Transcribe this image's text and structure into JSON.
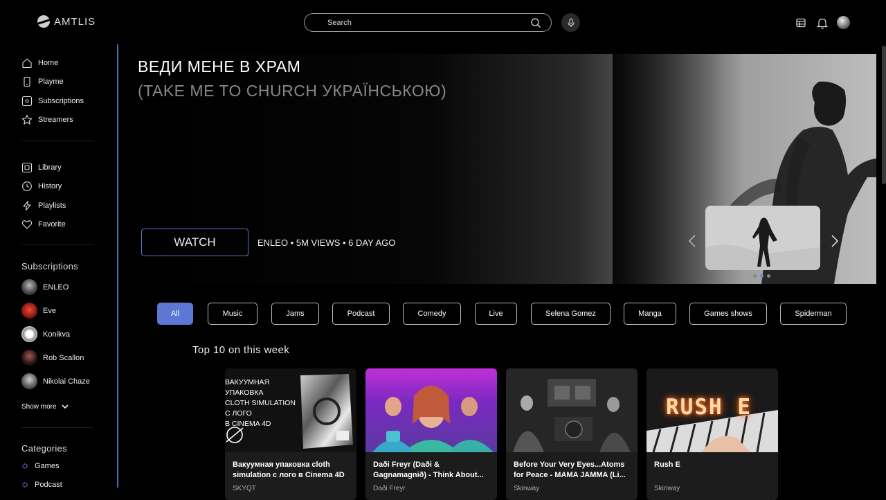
{
  "header": {
    "logo_text": "AMTLIS",
    "search_placeholder": "Search"
  },
  "sidebar": {
    "nav": [
      {
        "label": "Home",
        "icon": "home-icon"
      },
      {
        "label": "Playme",
        "icon": "phone-icon"
      },
      {
        "label": "Subscriptions",
        "icon": "subscriptions-icon"
      },
      {
        "label": "Streamers",
        "icon": "star-icon"
      }
    ],
    "library": [
      {
        "label": "Library",
        "icon": "library-icon"
      },
      {
        "label": "History",
        "icon": "clock-icon"
      },
      {
        "label": "Playlists",
        "icon": "lightning-icon"
      },
      {
        "label": "Favorite",
        "icon": "heart-icon"
      }
    ],
    "subscriptions_heading": "Subscriptions",
    "subscriptions": [
      {
        "name": "ENLEO"
      },
      {
        "name": "Eve"
      },
      {
        "name": "Konikva"
      },
      {
        "name": "Rob Scallon"
      },
      {
        "name": "Nikolai Chaze"
      }
    ],
    "show_more": "Show more",
    "categories_heading": "Categories",
    "categories": [
      {
        "label": "Games"
      },
      {
        "label": "Podcast"
      }
    ]
  },
  "hero": {
    "title": "ВЕДИ МЕНЕ В ХРАМ",
    "subtitle": "(TAKE ME TO CHURCH УКРАЇНСЬКОЮ)",
    "watch_label": "WATCH",
    "meta": "ENLEO • 5M VIEWS • 6 DAY AGO"
  },
  "chips": [
    "All",
    "Music",
    "Jams",
    "Podcast",
    "Comedy",
    "Live",
    "Selena Gomez",
    "Manga",
    "Games shows",
    "Spiderman"
  ],
  "top10": {
    "heading": "Top 10 on this week",
    "cards": [
      {
        "title": "Вакуумная упаковка cloth simulation с лого в Cinema 4D",
        "channel": "SKYQT",
        "thumb_text": "ВАКУУМНАЯ\nУПАКОВКА\nCLOTH SIMULATION\nС ЛОГО\nВ CINEMA 4D"
      },
      {
        "title": "Daði Freyr (Daði & Gagnamagnið) - Think About...",
        "channel": "Daði Freyr"
      },
      {
        "title": "Before Your Very Eyes...Atoms for Peace - MAMA JAMMA (Li...",
        "channel": "Skinway"
      },
      {
        "title": "Rush E",
        "channel": "Skinway",
        "thumb_text": "RUSH E"
      }
    ]
  }
}
